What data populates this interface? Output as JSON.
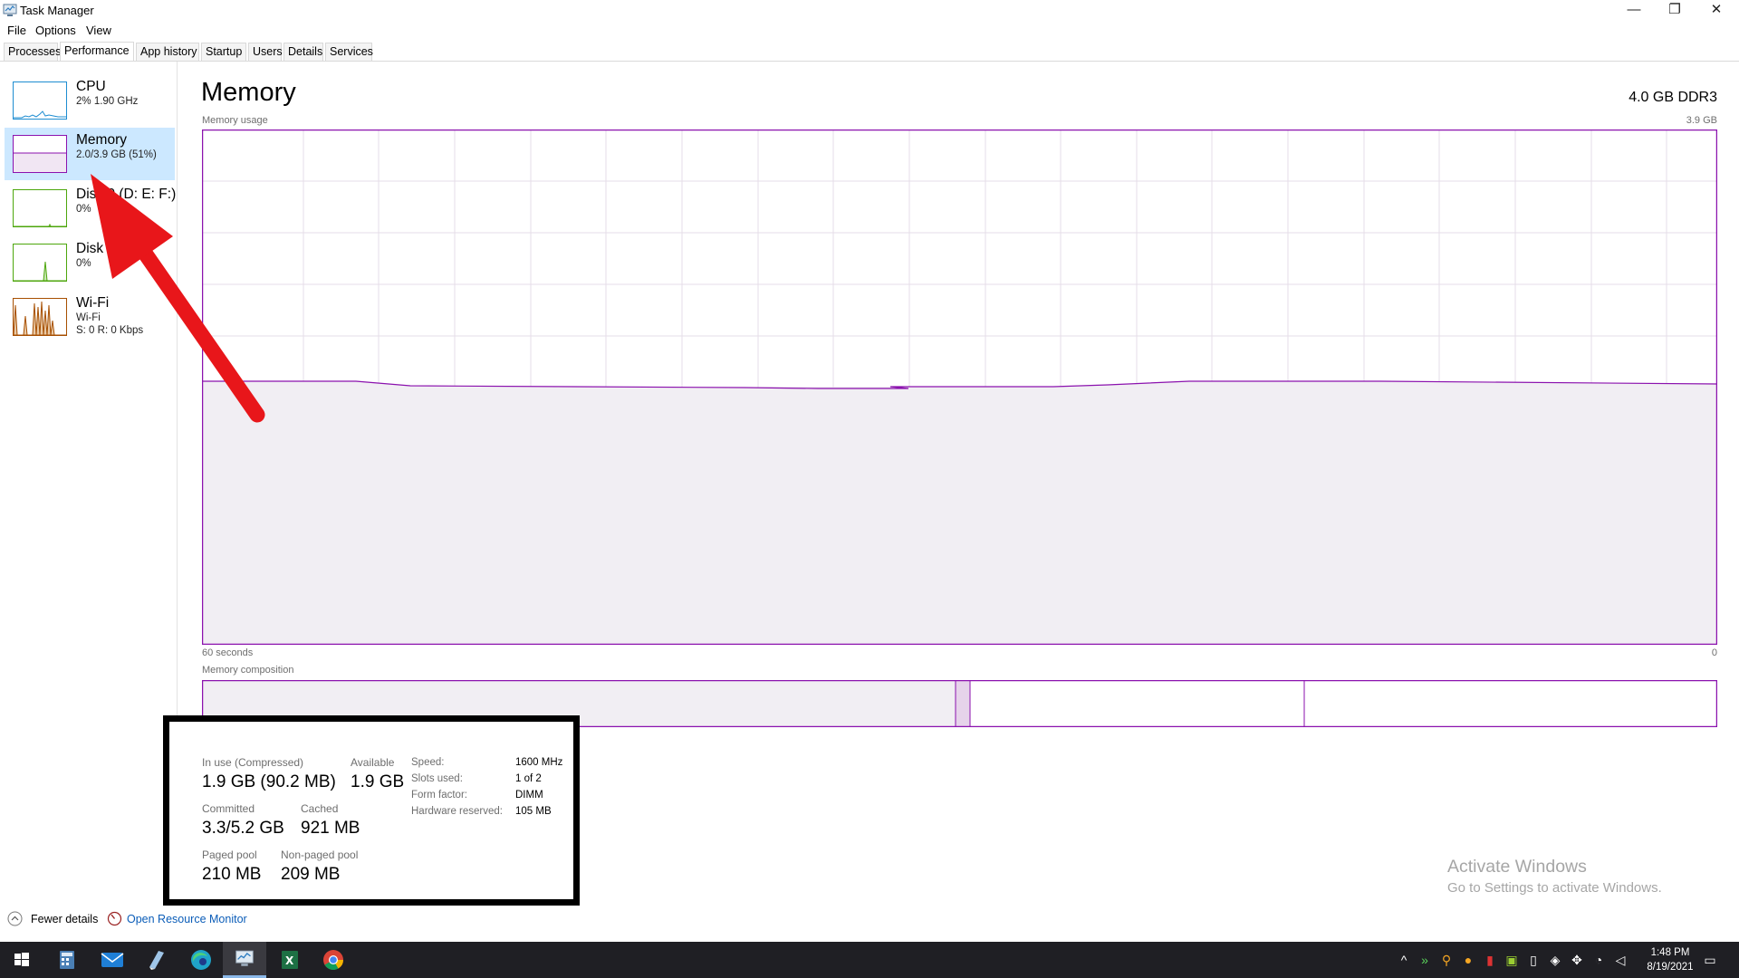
{
  "window": {
    "title": "Task Manager",
    "controls": {
      "minimize": "—",
      "restore": "❐",
      "close": "✕"
    }
  },
  "menu": [
    "File",
    "Options",
    "View"
  ],
  "tabs": [
    "Processes",
    "Performance",
    "App history",
    "Startup",
    "Users",
    "Details",
    "Services"
  ],
  "active_tab": "Performance",
  "sidebar": {
    "items": [
      {
        "title": "CPU",
        "sub1": "2% 1.90 GHz",
        "sub2": "",
        "color": "#1e8dd1"
      },
      {
        "title": "Memory",
        "sub1": "2.0/3.9 GB (51%)",
        "sub2": "",
        "color": "#8b12ae"
      },
      {
        "title": "Disk 0 (D: E: F:)",
        "sub1": "0%",
        "sub2": "",
        "color": "#4da60c"
      },
      {
        "title": "Disk",
        "sub1": "0%",
        "sub2": "",
        "color": "#4da60c"
      },
      {
        "title": "Wi-Fi",
        "sub1": "Wi-Fi",
        "sub2": "S: 0 R: 0 Kbps",
        "color": "#a74f01"
      }
    ],
    "selected": "Memory"
  },
  "main": {
    "title": "Memory",
    "spec": "4.0 GB DDR3",
    "usage_label": "Memory usage",
    "usage_max": "3.9 GB",
    "time_label": "60 seconds",
    "time_end": "0",
    "composition_label": "Memory composition",
    "graph_color": "#8b12ae",
    "usage_percent": 51
  },
  "stats": {
    "in_use_label": "In use (Compressed)",
    "in_use_value": "1.9 GB (90.2 MB)",
    "available_label": "Available",
    "available_value": "1.9 GB",
    "committed_label": "Committed",
    "committed_value": "3.3/5.2 GB",
    "cached_label": "Cached",
    "cached_value": "921 MB",
    "paged_label": "Paged pool",
    "paged_value": "210 MB",
    "nonpaged_label": "Non-paged pool",
    "nonpaged_value": "209 MB",
    "speed_label": "Speed:",
    "speed_value": "1600 MHz",
    "slots_label": "Slots used:",
    "slots_value": "1 of 2",
    "form_label": "Form factor:",
    "form_value": "DIMM",
    "hw_label": "Hardware reserved:",
    "hw_value": "105 MB"
  },
  "watermark": {
    "line1": "Activate Windows",
    "line2": "Go to Settings to activate Windows."
  },
  "footer": {
    "fewer_details": "Fewer details",
    "open_monitor": "Open Resource Monitor"
  },
  "taskbar": {
    "time": "1:48 PM",
    "date": "8/19/2021"
  }
}
